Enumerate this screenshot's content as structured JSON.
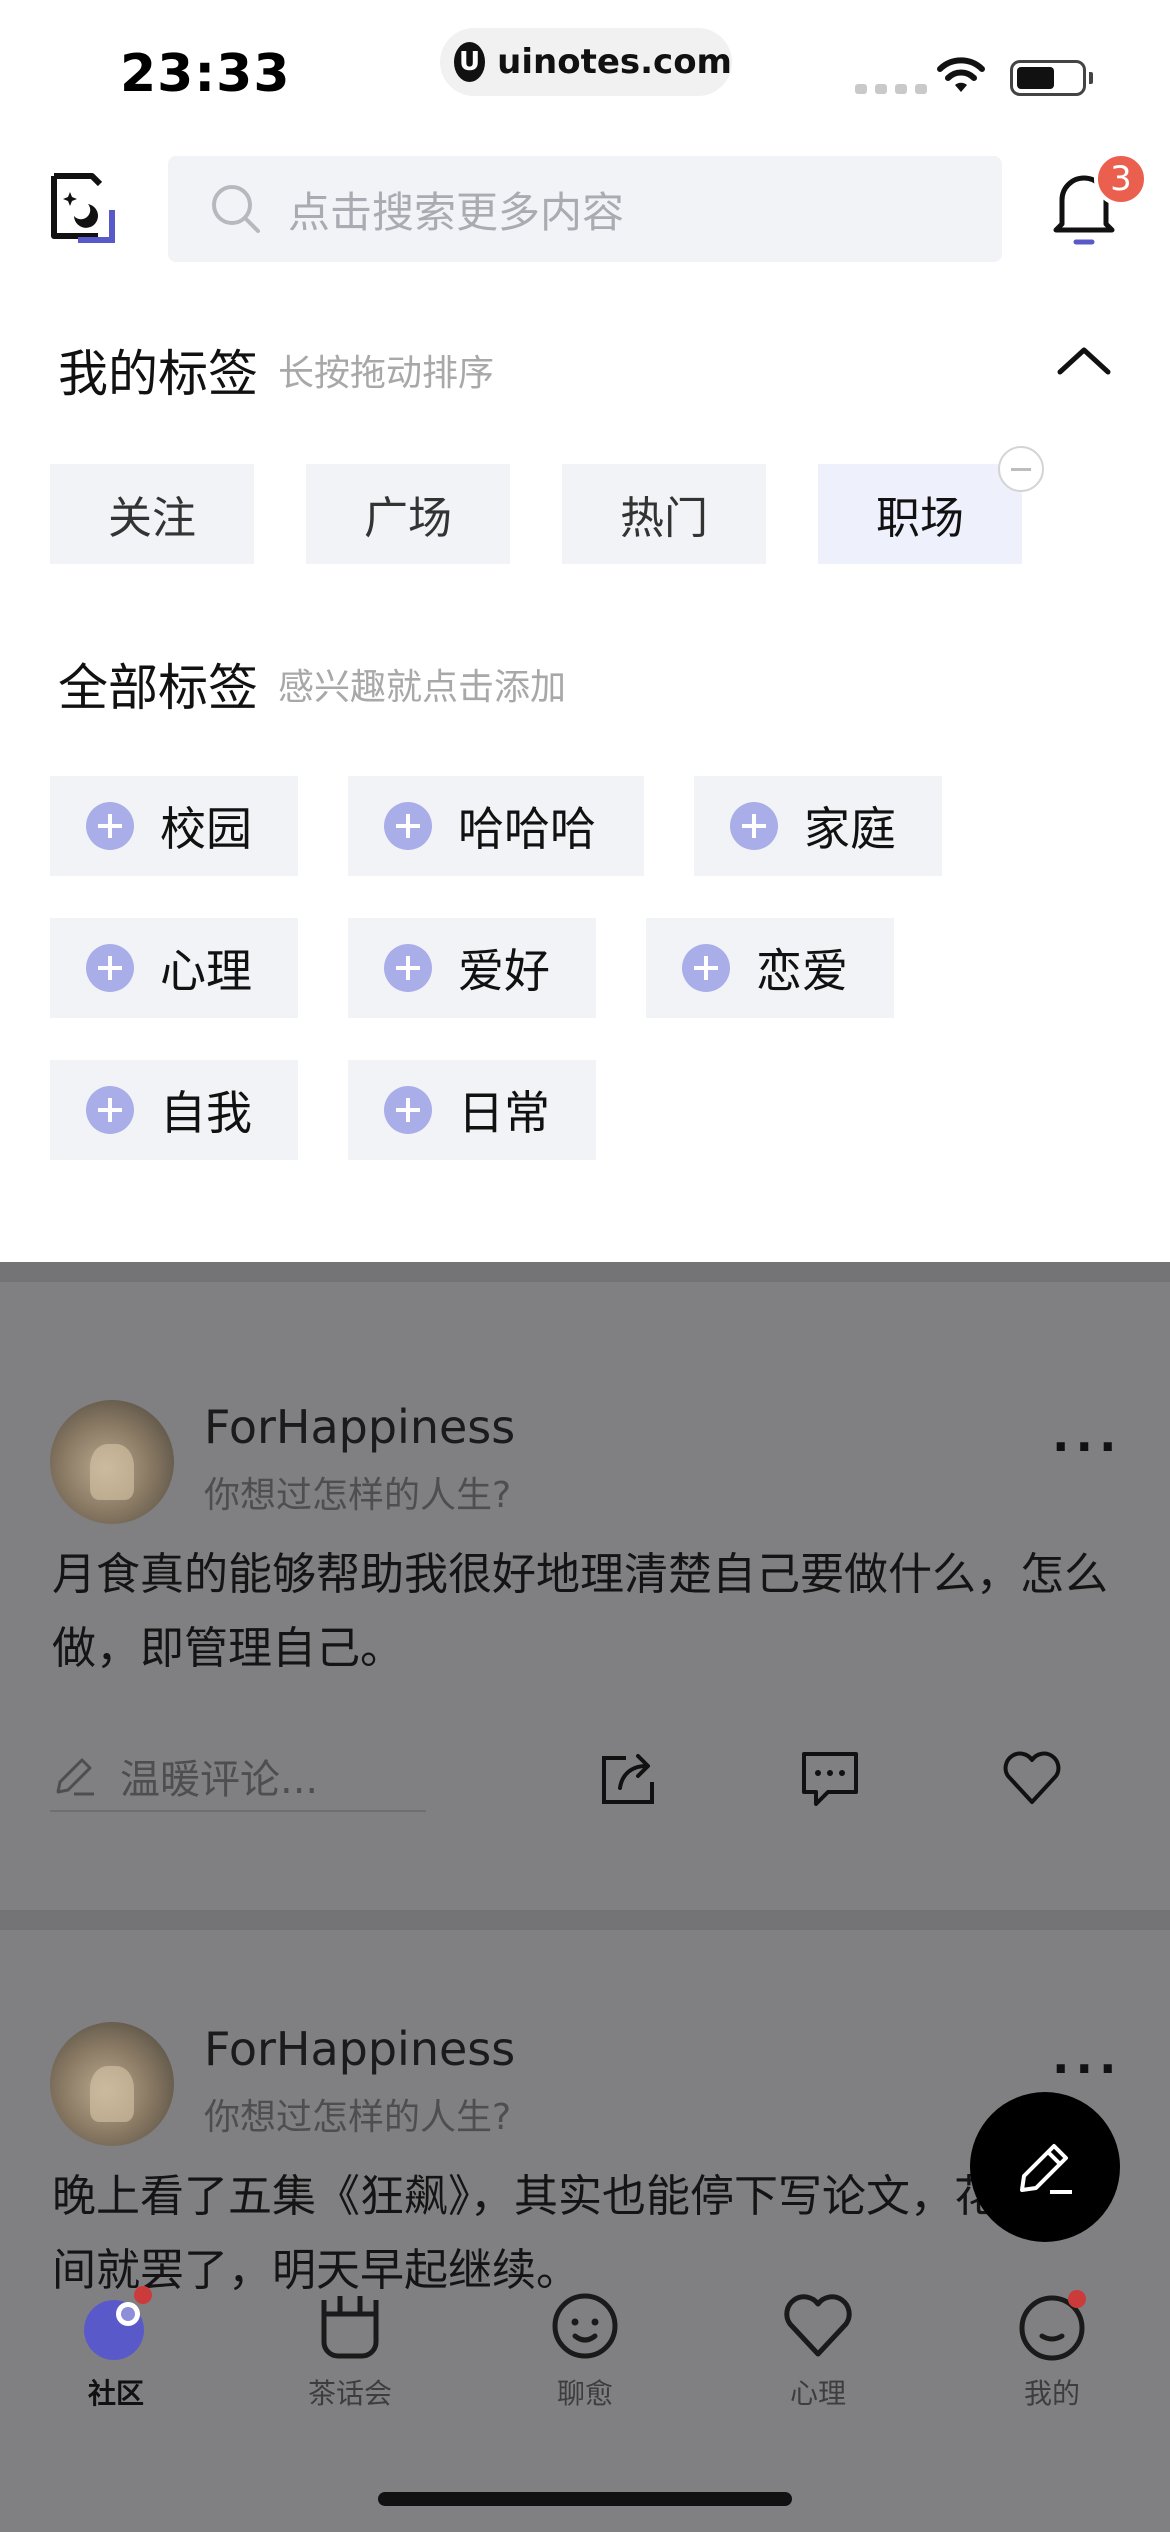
{
  "status_bar": {
    "time": "23:33",
    "url": "uinotes.com",
    "url_logo_letter": "U",
    "battery_level": 0.6
  },
  "header": {
    "search_placeholder": "点击搜索更多内容",
    "notification_count": "3"
  },
  "my_tags": {
    "title": "我的标签",
    "subtitle": "长按拖动排序",
    "items": [
      "关注",
      "广场",
      "热门",
      "职场"
    ],
    "active_index": 3
  },
  "all_tags": {
    "title": "全部标签",
    "subtitle": "感兴趣就点击添加",
    "rows": [
      [
        "校园",
        "哈哈哈",
        "家庭"
      ],
      [
        "心理",
        "爱好",
        "恋爱"
      ],
      [
        "自我",
        "日常"
      ]
    ]
  },
  "posts": [
    {
      "username": "ForHappiness",
      "subtitle": "你想过怎样的人生?",
      "more": "...",
      "text": "月食真的能够帮助我很好地理清楚自己要做什么，怎么做，即管理自己。",
      "comment_placeholder": "温暖评论..."
    },
    {
      "username": "ForHappiness",
      "subtitle": "你想过怎样的人生?",
      "more": "...",
      "text": "晚上看了五集《狂飙》，其实也能停下写论文，花了时间就罢了，明天早起继续。"
    }
  ],
  "tabbar": {
    "items": [
      {
        "label": "社区",
        "icon": "community-icon",
        "active": true,
        "dot": true
      },
      {
        "label": "茶话会",
        "icon": "tea-party-icon",
        "active": false,
        "dot": false
      },
      {
        "label": "聊愈",
        "icon": "chat-smile-icon",
        "active": false,
        "dot": false
      },
      {
        "label": "心理",
        "icon": "heart-icon",
        "active": false,
        "dot": false
      },
      {
        "label": "我的",
        "icon": "profile-face-icon",
        "active": false,
        "dot": true
      }
    ]
  },
  "colors": {
    "accent": "#a9aee8",
    "badge": "#eb5f4f",
    "overlay": "#7b7b7d"
  }
}
